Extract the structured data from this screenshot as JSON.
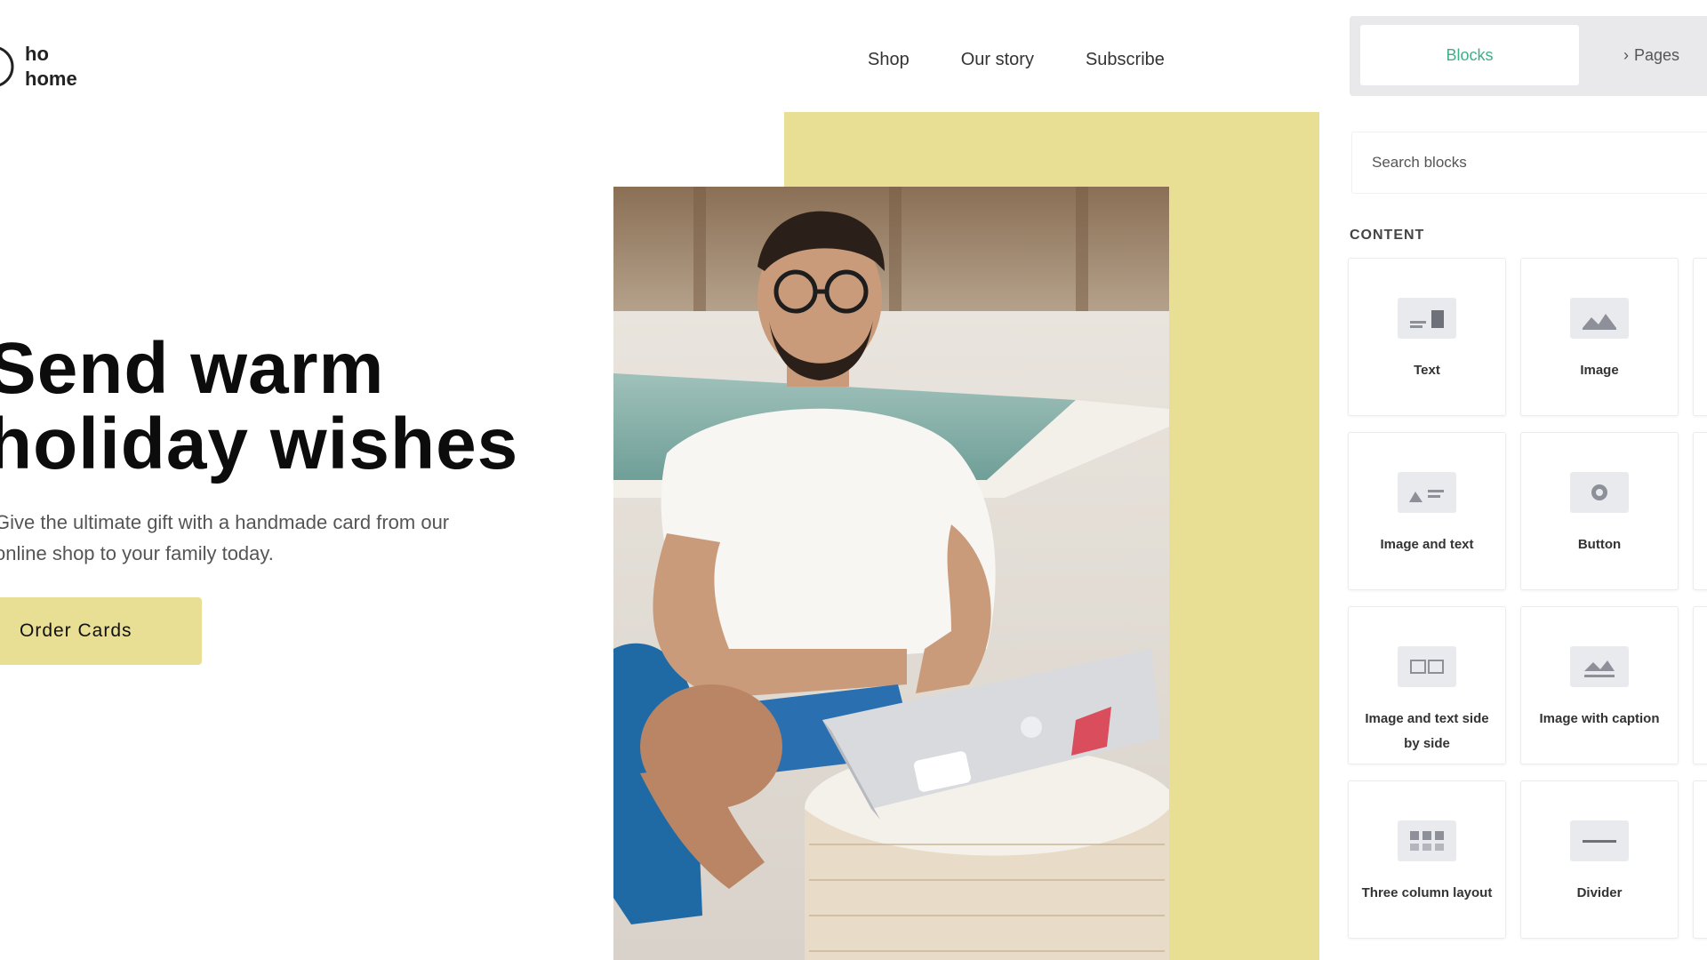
{
  "site": {
    "logo": {
      "line1": "ho",
      "line2": "home"
    },
    "nav": [
      "Shop",
      "Our story",
      "Subscribe"
    ]
  },
  "hero": {
    "title_line1": "Send warm",
    "title_line2": "holiday wishes",
    "subtitle": "Give the ultimate gift with a handmade card from our online shop to your family today.",
    "cta_label": "Order Cards"
  },
  "panel": {
    "tabs": {
      "add_label": "Blocks",
      "other_label": "Pages"
    },
    "search_placeholder": "Search blocks",
    "section_label": "CONTENT",
    "blocks": [
      {
        "label": "Text",
        "icon": "text-block-icon"
      },
      {
        "label": "Image",
        "icon": "image-block-icon"
      },
      {
        "label": "Image and text",
        "icon": "image-text-block-icon"
      },
      {
        "label": "Button",
        "icon": "button-block-icon"
      },
      {
        "label": "Image and text side by side",
        "icon": "side-by-side-block-icon"
      },
      {
        "label": "Image with caption",
        "icon": "caption-block-icon"
      },
      {
        "label": "Three column layout",
        "icon": "columns-block-icon"
      },
      {
        "label": "Divider",
        "icon": "divider-block-icon"
      }
    ]
  },
  "colors": {
    "accent_yellow": "#e8df95",
    "panel_tab_text": "#3fae8a"
  }
}
